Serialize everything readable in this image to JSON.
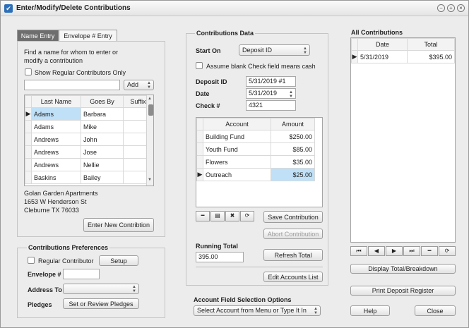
{
  "window": {
    "title": "Enter/Modify/Delete Contributions"
  },
  "tabs": [
    {
      "label": "Name Entry"
    },
    {
      "label": "Envelope # Entry"
    }
  ],
  "name_entry": {
    "instruction_line1": "Find a name for whom to enter or",
    "instruction_line2": "modify a contribution",
    "show_regular_label": "Show Regular Contributors Only",
    "search_value": "",
    "add_select": "Add",
    "columns": [
      "Last Name",
      "Goes By",
      "Suffix"
    ],
    "rows": [
      {
        "last": "Adams",
        "goes_by": "Barbara",
        "suffix": ""
      },
      {
        "last": "Adams",
        "goes_by": "Mike",
        "suffix": ""
      },
      {
        "last": "Andrews",
        "goes_by": "John",
        "suffix": ""
      },
      {
        "last": "Andrews",
        "goes_by": "Jose",
        "suffix": ""
      },
      {
        "last": "Andrews",
        "goes_by": "Nellie",
        "suffix": ""
      },
      {
        "last": "Baskins",
        "goes_by": "Bailey",
        "suffix": ""
      }
    ],
    "address_line1": "Golan  Garden  Apartments",
    "address_line2": "1653 W Henderson St",
    "address_line3": "Cleburne TX 76033",
    "enter_new_button": "Enter New Contribtion"
  },
  "prefs": {
    "title": "Contributions Preferences",
    "regular_label": "Regular Contributor",
    "setup_button": "Setup",
    "envelope_label": "Envelope #",
    "envelope_value": "",
    "address_to_label": "Address To",
    "address_to_value": "",
    "pledges_label": "Pledges",
    "pledges_button": "Set or Review Pledges"
  },
  "contrib_data": {
    "title": "Contributions Data",
    "start_on_label": "Start On",
    "start_on_value": "Deposit ID",
    "assume_blank_label": "Assume blank Check field means cash",
    "deposit_id_label": "Deposit ID",
    "deposit_id_value": "5/31/2019 #1",
    "date_label": "Date",
    "date_value": "5/31/2019",
    "check_label": "Check #",
    "check_value": "4321",
    "columns": [
      "Account",
      "Amount"
    ],
    "rows": [
      {
        "account": "Building Fund",
        "amount": "$250.00"
      },
      {
        "account": "Youth Fund",
        "amount": "$85.00"
      },
      {
        "account": "Flowers",
        "amount": "$35.00"
      },
      {
        "account": "Outreach",
        "amount": "$25.00"
      }
    ],
    "save_button": "Save Contribution",
    "abort_button": "Abort Contribution",
    "running_total_label": "Running Total",
    "running_total_value": "395.00",
    "refresh_button": "Refresh Total",
    "edit_accounts_button": "Edit Accounts List"
  },
  "account_field": {
    "title": "Account Field Selection Options",
    "select_value": "Select Account from Menu or Type It In"
  },
  "all_contrib": {
    "title": "All Contributions",
    "columns": [
      "Date",
      "Total"
    ],
    "rows": [
      {
        "date": "5/31/2019",
        "total": "$395.00"
      }
    ],
    "display_button": "Display Total/Breakdown",
    "print_button": "Print Deposit Register",
    "help_button": "Help",
    "close_button": "Close"
  }
}
